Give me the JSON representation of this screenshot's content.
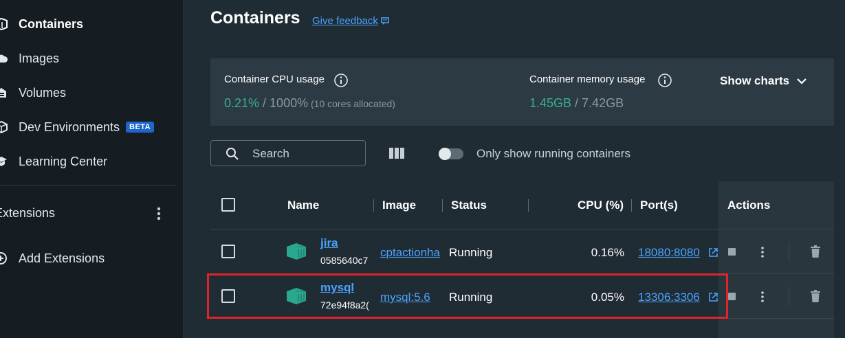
{
  "sidebar": {
    "items": [
      {
        "label": "Containers",
        "icon": "containers-icon",
        "active": true
      },
      {
        "label": "Images",
        "icon": "cloud-icon"
      },
      {
        "label": "Volumes",
        "icon": "volumes-icon"
      },
      {
        "label": "Dev Environments",
        "icon": "dev-env-icon",
        "badge": "BETA"
      },
      {
        "label": "Learning Center",
        "icon": "learning-icon"
      }
    ],
    "extensions_label": "Extensions",
    "add_extensions_label": "Add Extensions"
  },
  "header": {
    "title": "Containers",
    "feedback_label": "Give feedback"
  },
  "stats": {
    "cpu_label": "Container CPU usage",
    "cpu_used": "0.21%",
    "cpu_total": " / 1000%",
    "cpu_note": " (10 cores allocated)",
    "mem_label": "Container memory usage",
    "mem_used": "1.45GB",
    "mem_total": " / 7.42GB",
    "show_charts_label": "Show charts"
  },
  "toolbar": {
    "search_placeholder": "Search",
    "running_only_label": "Only show running containers",
    "running_only": false
  },
  "table": {
    "headers": {
      "name": "Name",
      "image": "Image",
      "status": "Status",
      "cpu": "CPU (%)",
      "ports": "Port(s)",
      "actions": "Actions"
    },
    "rows": [
      {
        "name": "jira",
        "id": "0585640c7",
        "image": "cptactionha",
        "status": "Running",
        "cpu": "0.16%",
        "port": "18080:8080"
      },
      {
        "name": "mysql",
        "id": "72e94f8a2(",
        "image": "mysql:5.6",
        "status": "Running",
        "cpu": "0.05%",
        "port": "13306:3306"
      }
    ]
  },
  "colors": {
    "accent": "#4aa3ff",
    "container_icon": "#2aa88f",
    "highlight": "#e0242d"
  }
}
